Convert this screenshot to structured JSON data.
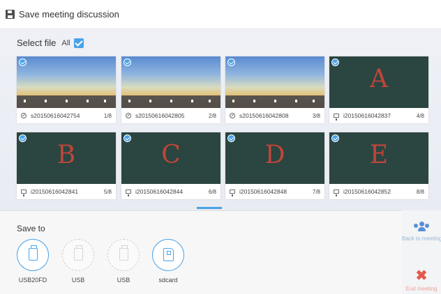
{
  "window": {
    "title": "Save meeting discussion"
  },
  "select": {
    "label": "Select file",
    "all_label": "All",
    "all_checked": true
  },
  "files": [
    {
      "kind": "screen",
      "icon": "clock-icon",
      "name": "s20150616042754",
      "page": "1/8",
      "checked": true
    },
    {
      "kind": "screen",
      "icon": "clock-icon",
      "name": "s20150616042805",
      "page": "2/8",
      "checked": true
    },
    {
      "kind": "screen",
      "icon": "clock-icon",
      "name": "s20150616042808",
      "page": "3/8",
      "checked": true
    },
    {
      "kind": "board",
      "letter": "A",
      "icon": "monitor-icon",
      "name": "i20150616042837",
      "page": "4/8",
      "checked": true
    },
    {
      "kind": "board",
      "letter": "B",
      "icon": "monitor-icon",
      "name": "i20150616042841",
      "page": "5/8",
      "checked": true
    },
    {
      "kind": "board",
      "letter": "C",
      "icon": "monitor-icon",
      "name": "i20150616042844",
      "page": "6/8",
      "checked": true
    },
    {
      "kind": "board",
      "letter": "D",
      "icon": "monitor-icon",
      "name": "i20150616042848",
      "page": "7/8",
      "checked": true
    },
    {
      "kind": "board",
      "letter": "E",
      "icon": "monitor-icon",
      "name": "i20150616042852",
      "page": "8/8",
      "checked": true
    }
  ],
  "save": {
    "label": "Save to",
    "devices": [
      {
        "name": "USB20FD",
        "icon": "usb-drive-icon",
        "active": true
      },
      {
        "name": "USB",
        "icon": "usb-drive-icon",
        "active": false
      },
      {
        "name": "USB",
        "icon": "usb-drive-icon",
        "active": false
      },
      {
        "name": "sdcard",
        "icon": "sd-card-icon",
        "active": true
      }
    ]
  },
  "sidebar": {
    "back_label": "Back to meeting",
    "end_label": "End meeting"
  },
  "colors": {
    "accent": "#4aa3e8",
    "board": "#2b4540",
    "ink": "#c0453a",
    "end": "#e45a4a"
  }
}
